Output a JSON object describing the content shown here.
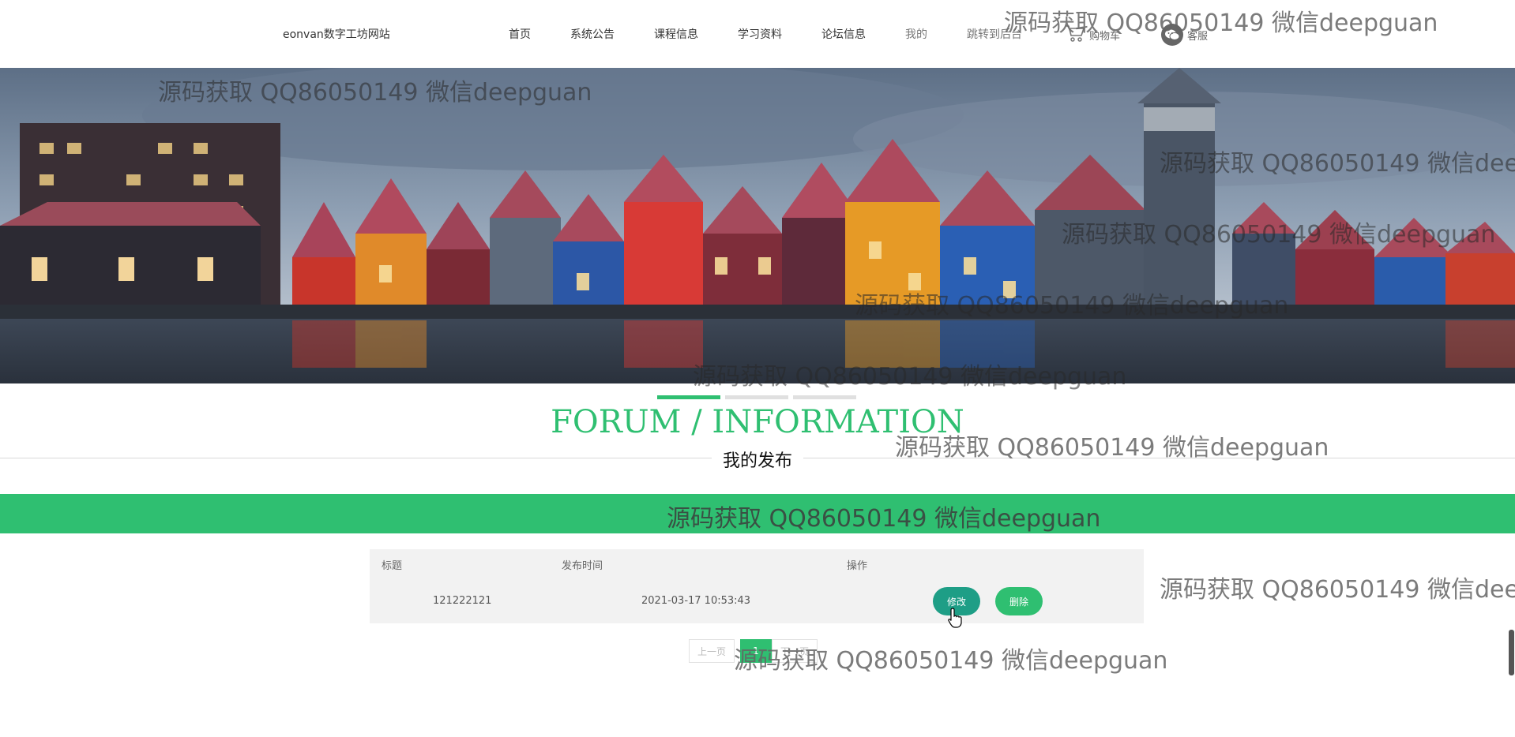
{
  "header": {
    "site_title": "eonvan数字工坊网站",
    "nav": [
      {
        "label": "首页"
      },
      {
        "label": "系统公告"
      },
      {
        "label": "课程信息"
      },
      {
        "label": "学习资料"
      },
      {
        "label": "论坛信息"
      },
      {
        "label": "我的"
      },
      {
        "label": "跳转到后台"
      }
    ],
    "cart_label": "购物车",
    "service_label": "客服"
  },
  "banner": {
    "slide_count": 3,
    "active_slide": 1
  },
  "section": {
    "title_en": "FORUM / INFORMATION",
    "title_cn": "我的发布"
  },
  "table": {
    "headers": [
      "标题",
      "发布时间",
      "操作"
    ],
    "rows": [
      {
        "title": "121222121",
        "time": "2021-03-17 10:53:43",
        "edit_label": "修改",
        "delete_label": "删除"
      }
    ]
  },
  "pagination": {
    "prev_label": "上一页",
    "current": "1",
    "next_label": "下一页"
  },
  "watermark": {
    "text": "源码获取 QQ86050149 微信deepguan"
  },
  "colors": {
    "accent": "#2fbf71",
    "edit_button": "#1e9e86"
  }
}
